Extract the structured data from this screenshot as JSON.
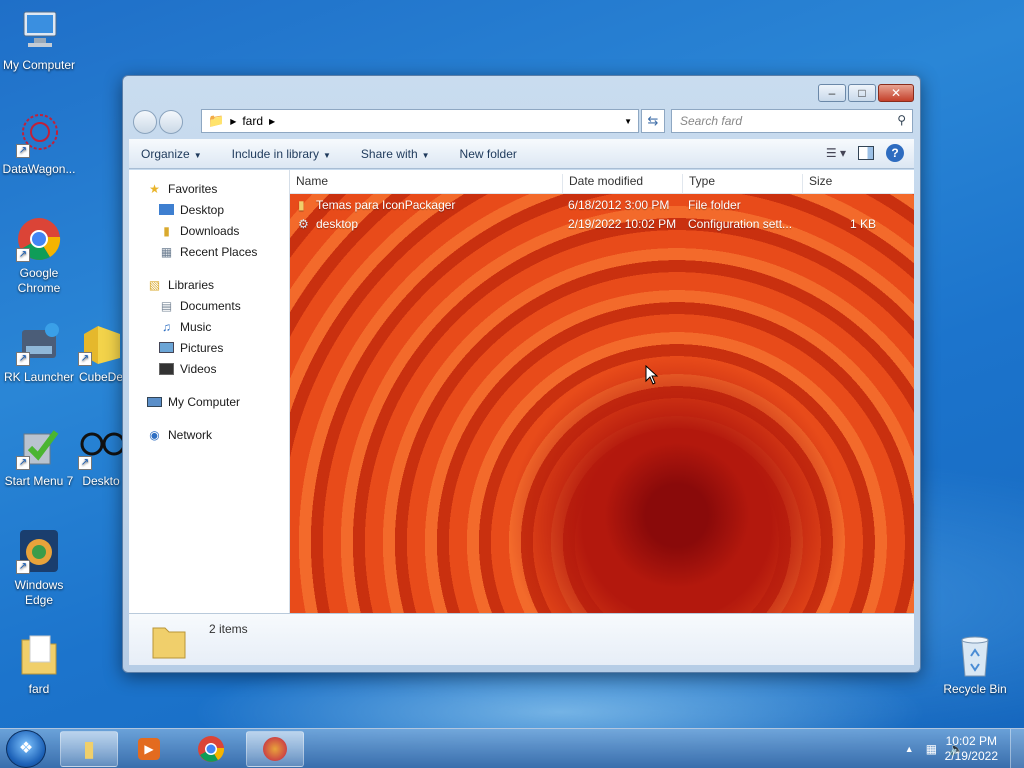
{
  "desktop": {
    "icons": [
      {
        "label": "My Computer"
      },
      {
        "label": "DataWagon..."
      },
      {
        "label": "Google Chrome"
      },
      {
        "label": "RK Launcher"
      },
      {
        "label": "CubeDe"
      },
      {
        "label": "Start Menu 7"
      },
      {
        "label": "Deskto"
      },
      {
        "label": "Windows Edge"
      },
      {
        "label": "fard"
      },
      {
        "label": "Recycle Bin"
      }
    ]
  },
  "window": {
    "breadcrumb": [
      "fard"
    ],
    "search_placeholder": "Search fard",
    "commands": [
      "Organize",
      "Include in library",
      "Share with",
      "New folder"
    ],
    "nav": {
      "favorites": "Favorites",
      "fav_items": [
        "Desktop",
        "Downloads",
        "Recent Places"
      ],
      "libraries": "Libraries",
      "lib_items": [
        "Documents",
        "Music",
        "Pictures",
        "Videos"
      ],
      "computer": "My Computer",
      "network": "Network"
    },
    "columns": [
      "Name",
      "Date modified",
      "Type",
      "Size"
    ],
    "files": [
      {
        "name": "Temas para IconPackager",
        "date": "6/18/2012 3:00 PM",
        "type": "File folder",
        "size": ""
      },
      {
        "name": "desktop",
        "date": "2/19/2022 10:02 PM",
        "type": "Configuration sett...",
        "size": "1 KB"
      }
    ],
    "status": "2 items"
  },
  "taskbar": {
    "time": "10:02 PM",
    "date": "2/19/2022"
  },
  "colors": {
    "accent": "#1f6fc8",
    "window_frame": "#c9dcef"
  }
}
